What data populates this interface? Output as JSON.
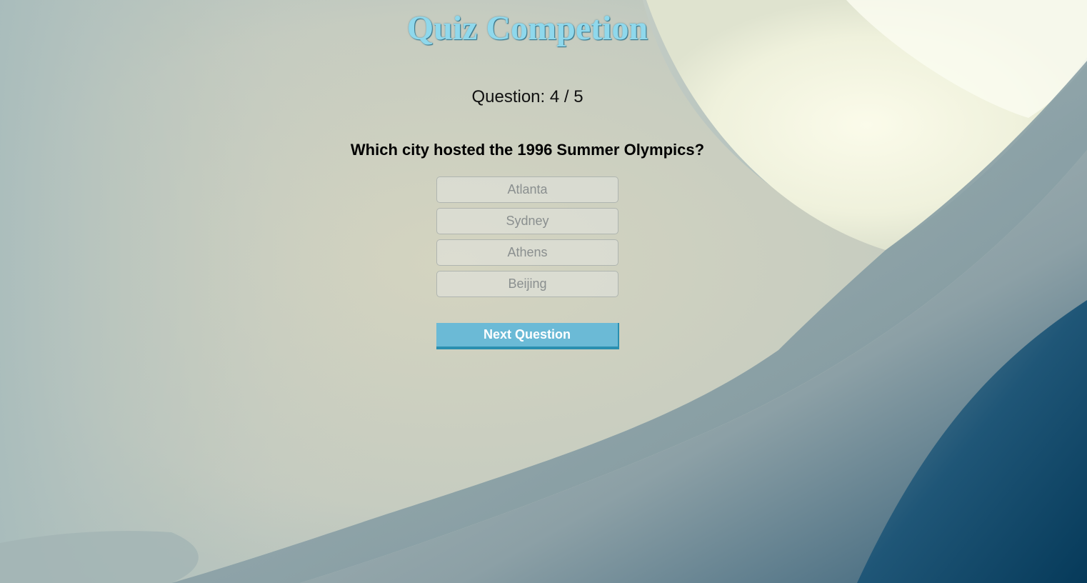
{
  "app": {
    "title": "Quiz Competion"
  },
  "quiz": {
    "counter_text": "Question: 4 / 5",
    "question_text": "Which city hosted the 1996 Summer Olympics?",
    "options": [
      {
        "label": "Atlanta"
      },
      {
        "label": "Sydney"
      },
      {
        "label": "Athens"
      },
      {
        "label": "Beijing"
      }
    ],
    "next_label": "Next Question"
  },
  "colors": {
    "title": "#8fd8ec",
    "next_button": "#6bbad6",
    "next_button_border": "#2a8fb0",
    "dark_accent": "#0e4463"
  }
}
